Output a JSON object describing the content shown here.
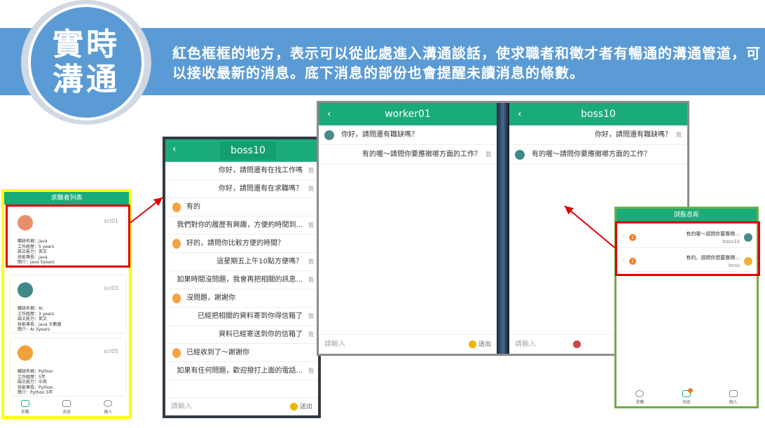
{
  "badge": {
    "title": "實時溝通"
  },
  "banner": {
    "text": "紅色框框的地方，表示可以從此處進入溝通談話，使求職者和徵才者有暢通的溝通管道，可以接收最新的消息。底下消息的部份也會提醒未讀消息的條數。"
  },
  "seeker_list": {
    "header": "求職者列表",
    "cards": [
      {
        "id": "sci01",
        "info": [
          "職缺名稱：java",
          "工作經歷：5 years",
          "語文能力：英文",
          "技能專長：java",
          "簡介：java 5years"
        ]
      },
      {
        "id": "sci03",
        "info": [
          "職缺名稱：AI",
          "工作經歷：3 years",
          "語文能力：英文",
          "技能專長：java 大數據",
          "簡介：AI 3years"
        ]
      },
      {
        "id": "sci05",
        "info": [
          "職缺名稱：Python",
          "工作經歷：5年",
          "語文能力：中英",
          "技能專長：Python",
          "簡介：Python 5年"
        ]
      }
    ],
    "nav": [
      "求職",
      "消息",
      "個人"
    ]
  },
  "chat_boss10": {
    "title": "boss10",
    "back": "‹",
    "messages": [
      {
        "side": "r",
        "text": "你好，請問還有在找工作嗎",
        "me": "我"
      },
      {
        "side": "r",
        "text": "你好，請問還有在求職嗎？",
        "me": "我"
      },
      {
        "side": "l",
        "text": "有的"
      },
      {
        "side": "r",
        "text": "我們對你的履歷有興趣，方便約時間到...",
        "me": "我"
      },
      {
        "side": "l",
        "text": "好的，請問你比較方便的時間？"
      },
      {
        "side": "r",
        "text": "這星期五上午10點方便嗎？",
        "me": "我"
      },
      {
        "side": "r",
        "text": "如果時間沒問題，我會再把相關的訊息...",
        "me": "我"
      },
      {
        "side": "l",
        "text": "沒問題，謝謝你"
      },
      {
        "side": "r",
        "text": "已經把相關的資料寄到你得信箱了",
        "me": "我"
      },
      {
        "side": "r",
        "text": "資料已經寄送到你的信箱了",
        "me": "我"
      },
      {
        "side": "l",
        "text": "已經收到了～謝謝你"
      },
      {
        "side": "r",
        "text": "如果有任何問題，歡迎撥打上面的電話...",
        "me": "我"
      }
    ],
    "input_placeholder": "請輸入",
    "send": "送出"
  },
  "chat_worker01": {
    "title": "worker01",
    "back": "‹",
    "messages": [
      {
        "side": "l",
        "text": "你好，請問還有職缺嗎？"
      },
      {
        "side": "r",
        "text": "有的喔～請問你要應徵哪方面的工作？",
        "me": "我"
      }
    ],
    "input_placeholder": "請輸入",
    "send": "送出"
  },
  "chat_boss10_right": {
    "title": "boss10",
    "back": "‹",
    "messages": [
      {
        "side": "r",
        "text": "你好，請問還有職缺嗎？",
        "me": "我"
      },
      {
        "side": "l",
        "text": "有的喔～請問你要應徵哪方面的工作？"
      }
    ],
    "input_placeholder": "請輸入"
  },
  "notifications": {
    "header": "消息通知",
    "items": [
      {
        "text": "有的喔～請問你要應徵...",
        "sender": "boss10",
        "count": "1"
      },
      {
        "text": "有的，請問你想要應徵...",
        "sender": "boss",
        "count": "1"
      }
    ],
    "nav": [
      "求職",
      "消息",
      "個人"
    ]
  },
  "colors": {
    "banner": "#5b9bd5",
    "header_green": "#1aab7a",
    "highlight_red": "#e00000",
    "frame_yellow": "#ffff00",
    "frame_green": "#6fad47"
  }
}
